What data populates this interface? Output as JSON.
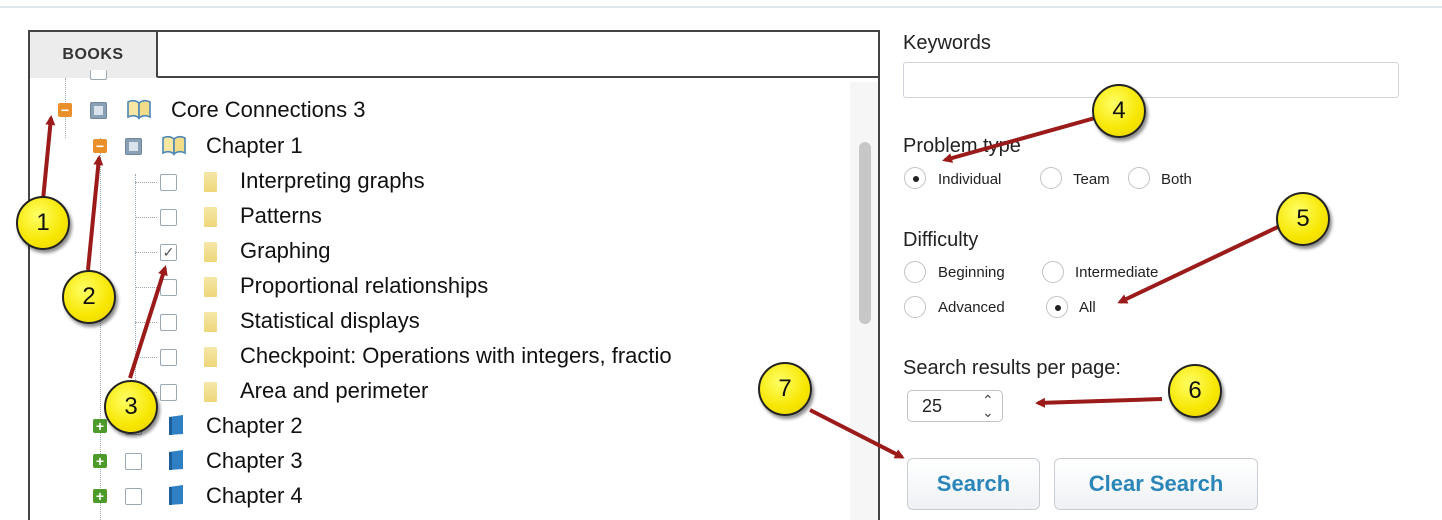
{
  "tabs": {
    "books_label": "BOOKS"
  },
  "tree": {
    "items": [
      {
        "label": "Core Connections 3",
        "level": 0,
        "toggle": "minus",
        "check": "partial",
        "icon": "open-book"
      },
      {
        "label": "Chapter 1",
        "level": 1,
        "toggle": "minus",
        "check": "partial",
        "icon": "open-book"
      },
      {
        "label": "Interpreting graphs",
        "level": 2,
        "check": "unchecked",
        "icon": "folder"
      },
      {
        "label": "Patterns",
        "level": 2,
        "check": "unchecked",
        "icon": "folder"
      },
      {
        "label": "Graphing",
        "level": 2,
        "check": "checked",
        "icon": "folder"
      },
      {
        "label": "Proportional relationships",
        "level": 2,
        "check": "unchecked",
        "icon": "folder"
      },
      {
        "label": "Statistical displays",
        "level": 2,
        "check": "unchecked",
        "icon": "folder"
      },
      {
        "label": "Checkpoint: Operations with integers, fractio",
        "level": 2,
        "check": "unchecked",
        "icon": "folder"
      },
      {
        "label": "Area and perimeter",
        "level": 2,
        "check": "unchecked",
        "icon": "folder"
      },
      {
        "label": "Chapter 2",
        "level": 1,
        "toggle": "plus",
        "check": "unchecked",
        "icon": "closed-book"
      },
      {
        "label": "Chapter 3",
        "level": 1,
        "toggle": "plus",
        "check": "unchecked",
        "icon": "closed-book"
      },
      {
        "label": "Chapter 4",
        "level": 1,
        "toggle": "plus",
        "check": "unchecked",
        "icon": "closed-book"
      }
    ]
  },
  "form": {
    "keywords_label": "Keywords",
    "keywords_value": "",
    "problem_type_label": "Problem type",
    "problem_type_options": [
      "Individual",
      "Team",
      "Both"
    ],
    "problem_type_selected": "Individual",
    "difficulty_label": "Difficulty",
    "difficulty_options": [
      "Beginning",
      "Intermediate",
      "Advanced",
      "All"
    ],
    "difficulty_selected": "All",
    "results_label": "Search results per page:",
    "results_value": "25",
    "search_label": "Search",
    "clear_label": "Clear Search"
  },
  "annotations": [
    "1",
    "2",
    "3",
    "4",
    "5",
    "6",
    "7"
  ],
  "colors": {
    "annotation_fill": "#f7e600",
    "arrow": "#9b1b1b",
    "button_text": "#2a86b8",
    "minus_toggle": "#e9902b",
    "plus_toggle": "#4c9a2a"
  }
}
